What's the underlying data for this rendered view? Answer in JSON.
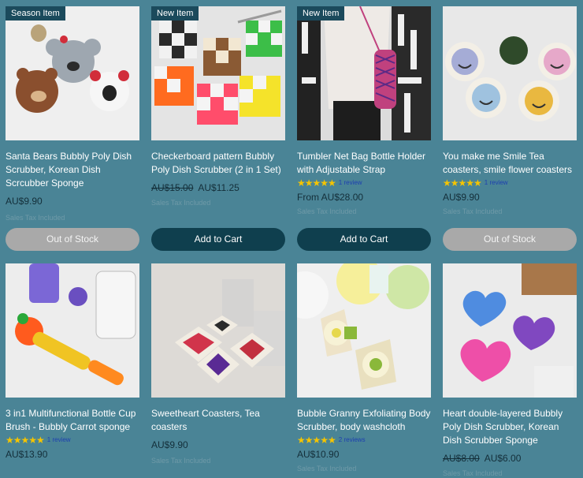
{
  "products": [
    {
      "badge": "Season Item",
      "title": "Santa Bears Bubbly Poly Dish Scrubber, Korean Dish Scrcubber Sponge",
      "price": "AU$9.90",
      "tax": "Sales Tax Included",
      "button": "Out of Stock",
      "image": "santa-bears-scrubber-image"
    },
    {
      "badge": "New Item",
      "title": "Checkerboard pattern Bubbly Poly Dish Scrubber (2 in 1 Set)",
      "old_price": "AU$15.00",
      "price": "AU$11.25",
      "tax": "Sales Tax Included",
      "button": "Add to Cart",
      "image": "checkerboard-scrubber-image"
    },
    {
      "badge": "New Item",
      "title": "Tumbler Net Bag Bottle Holder with Adjustable Strap",
      "stars": "★★★★★",
      "reviews": "1 review",
      "price": "From AU$28.00",
      "tax": "Sales Tax Included",
      "button": "Add to Cart",
      "image": "tumbler-net-bag-image"
    },
    {
      "title": "You make me Smile Tea coasters, smile flower coasters",
      "stars": "★★★★★",
      "reviews": "1 review",
      "price": "AU$9.90",
      "tax": "Sales Tax Included",
      "button": "Out of Stock",
      "image": "smile-flower-coasters-image"
    },
    {
      "title": "3 in1 Multifunctional Bottle Cup Brush - Bubbly Carrot sponge",
      "stars": "★★★★★",
      "reviews": "1 review",
      "price": "AU$13.90",
      "image": "carrot-bottle-brush-image"
    },
    {
      "title": "Sweetheart Coasters, Tea coasters",
      "price": "AU$9.90",
      "tax": "Sales Tax Included",
      "image": "sweetheart-coasters-image"
    },
    {
      "title": "Bubble Granny Exfoliating Body Scrubber, body washcloth",
      "stars": "★★★★★",
      "reviews": "2 reviews",
      "price": "AU$10.90",
      "tax": "Sales Tax Included",
      "image": "granny-body-scrubber-image"
    },
    {
      "title": "Heart double-layered Bubbly Poly Dish Scrubber, Korean Dish Scrubber Sponge",
      "old_price": "AU$8.00",
      "price": "AU$6.00",
      "tax": "Sales Tax Included",
      "image": "heart-scrubber-image"
    }
  ],
  "colors": {
    "background": "#4a8496",
    "badge": "#1b4a5c",
    "add_to_cart": "#0f3f4e",
    "out_of_stock": "#a9a9a9",
    "stars": "#f5c400"
  }
}
